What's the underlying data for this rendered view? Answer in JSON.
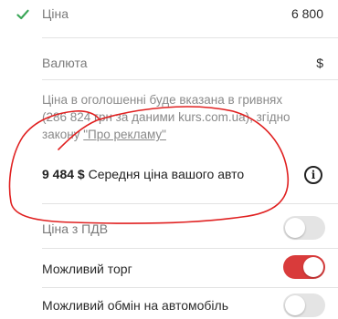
{
  "price": {
    "label": "Ціна",
    "value": "6 800",
    "check_color": "#3aa657"
  },
  "currency": {
    "label": "Валюта",
    "value": "$"
  },
  "uah_notice": {
    "line1": "Ціна в оголошенні буде вказана в гривнях",
    "line2": "(286 824 грн за даними kurs.com.ua), згідно",
    "line3_prefix": "закону ",
    "law_link": "\"Про рекламу\""
  },
  "average_price": {
    "amount": "9 484 $",
    "label": "Середня ціна вашого авто",
    "info_icon": "info-icon"
  },
  "toggles": [
    {
      "label": "Ціна з ПДВ",
      "state": "off"
    },
    {
      "label": "Можливий торг",
      "state": "on"
    },
    {
      "label": "Можливий обмін на автомобіль",
      "state": "off"
    }
  ],
  "colors": {
    "accent_red": "#d93b3b",
    "check_green": "#3aa657",
    "annotation_red": "#e02020"
  }
}
